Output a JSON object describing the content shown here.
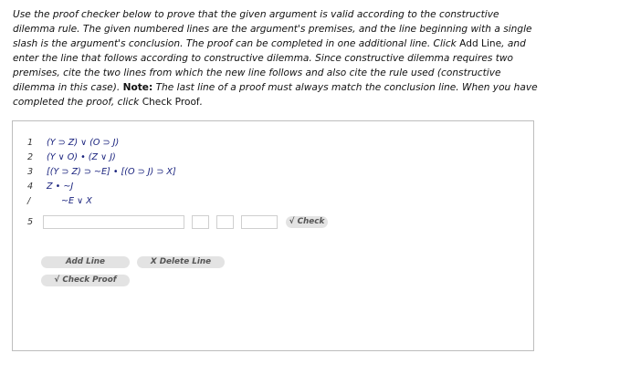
{
  "instructions": {
    "p1": "Use the proof checker below to prove that the given argument is valid according to the constructive dilemma rule. The given numbered lines are the argument's premises, and the line beginning with a single slash is the argument's conclusion. The proof can be completed in one additional line. Click ",
    "add_line_ref": "Add Line",
    "p2": ", and enter the line that follows according to constructive dilemma. Since constructive dilemma requires two premises, cite the two lines from which the new line follows and also cite the rule used (constructive dilemma in this case). ",
    "note_label": "Note:",
    "p3": " The last line of a proof must always match the conclusion line. When you have completed the proof, click ",
    "check_proof_ref": "Check Proof",
    "p4": "."
  },
  "proof": {
    "lines": [
      {
        "num": "1",
        "formula": "(Y ⊃ Z) ∨ (O ⊃ J)"
      },
      {
        "num": "2",
        "formula": "(Y ∨ O) • (Z ∨ J)"
      },
      {
        "num": "3",
        "formula": "[(Y ⊃ Z) ⊃ ~E] • [(O ⊃ J) ⊃ X]"
      },
      {
        "num": "4",
        "formula": "Z • ~J"
      }
    ],
    "conclusion": {
      "num": "/",
      "formula": "~E ∨ X"
    },
    "entry": {
      "num": "5",
      "formula_value": "",
      "cite1_value": "",
      "cite2_value": "",
      "rule_value": ""
    }
  },
  "buttons": {
    "check": "√ Check",
    "add_line": "Add Line",
    "delete_line": "X  Delete Line",
    "check_proof": "√  Check Proof"
  }
}
